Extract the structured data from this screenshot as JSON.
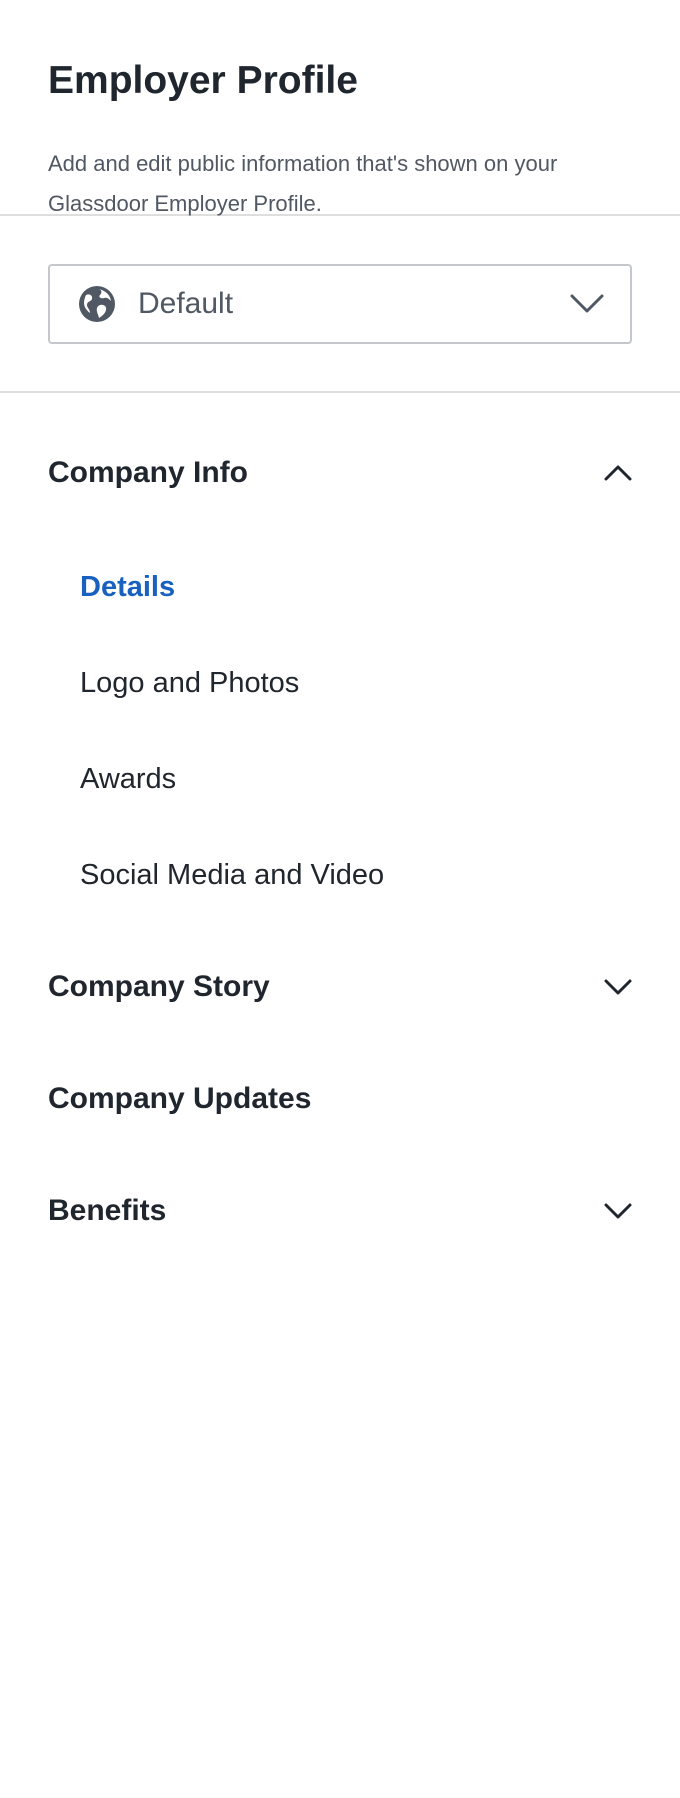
{
  "header": {
    "title": "Employer Profile",
    "description": "Add and edit public information that's shown on your Glassdoor Employer Profile."
  },
  "profile_selector": {
    "icon": "globe-icon",
    "value": "Default",
    "chevron": "chevron-down-icon"
  },
  "nav": {
    "company_info": {
      "label": "Company Info",
      "expanded": true,
      "items": [
        {
          "label": "Details",
          "active": true
        },
        {
          "label": "Logo and Photos",
          "active": false
        },
        {
          "label": "Awards",
          "active": false
        },
        {
          "label": "Social Media and Video",
          "active": false
        }
      ]
    },
    "company_story": {
      "label": "Company Story",
      "expanded": false
    },
    "company_updates": {
      "label": "Company Updates"
    },
    "benefits": {
      "label": "Benefits",
      "expanded": false
    }
  },
  "colors": {
    "accent": "#1861bf",
    "text": "#20262e",
    "muted": "#505863",
    "divider": "#dedede",
    "border": "#c4c7cc"
  }
}
